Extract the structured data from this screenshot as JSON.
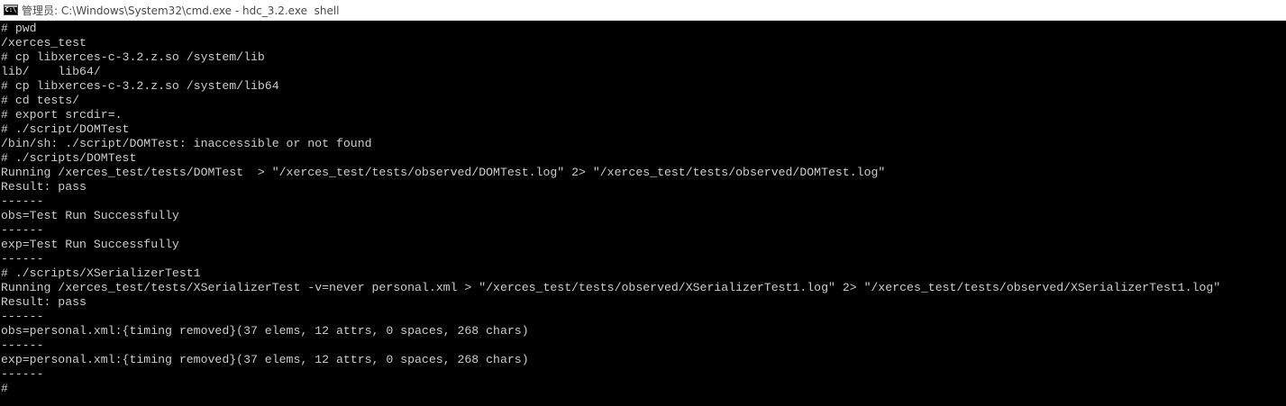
{
  "window": {
    "title": "管理员: C:\\Windows\\System32\\cmd.exe - hdc_3.2.exe  shell",
    "icon_label": "C:\\",
    "background": "#000000",
    "text_color": "#cccccc"
  },
  "console": {
    "lines": [
      "# pwd",
      "/xerces_test",
      "# cp libxerces-c-3.2.z.so /system/lib",
      "lib/    lib64/",
      "# cp libxerces-c-3.2.z.so /system/lib64",
      "# cd tests/",
      "# export srcdir=.",
      "# ./script/DOMTest",
      "/bin/sh: ./script/DOMTest: inaccessible or not found",
      "# ./scripts/DOMTest",
      "Running /xerces_test/tests/DOMTest  > \"/xerces_test/tests/observed/DOMTest.log\" 2> \"/xerces_test/tests/observed/DOMTest.log\"",
      "Result: pass",
      "------",
      "obs=Test Run Successfully",
      "------",
      "exp=Test Run Successfully",
      "------",
      "# ./scripts/XSerializerTest1",
      "Running /xerces_test/tests/XSerializerTest -v=never personal.xml > \"/xerces_test/tests/observed/XSerializerTest1.log\" 2> \"/xerces_test/tests/observed/XSerializerTest1.log\"",
      "Result: pass",
      "------",
      "obs=personal.xml:{timing removed}(37 elems, 12 attrs, 0 spaces, 268 chars)",
      "------",
      "exp=personal.xml:{timing removed}(37 elems, 12 attrs, 0 spaces, 268 chars)",
      "------",
      "#"
    ]
  }
}
